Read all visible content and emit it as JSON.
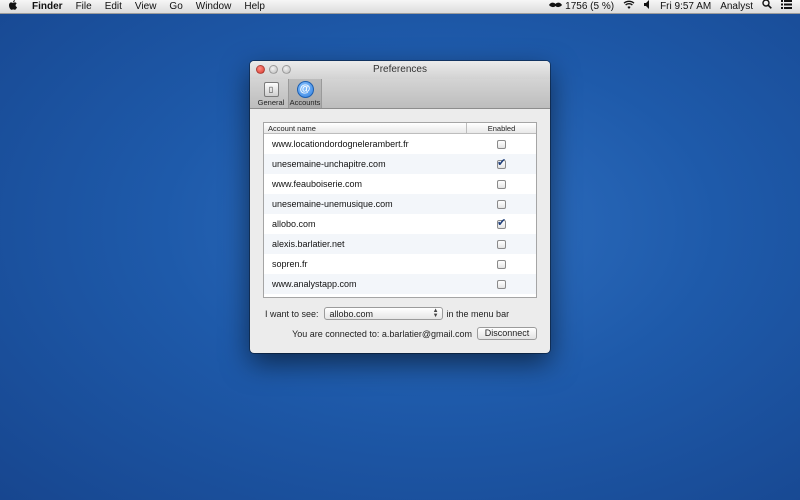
{
  "menubar": {
    "apple": "",
    "app": "Finder",
    "items": [
      "File",
      "Edit",
      "View",
      "Go",
      "Window",
      "Help"
    ],
    "status": {
      "activity": "1756 (5 %)",
      "clock": "Fri 9:57 AM",
      "user": "Analyst"
    }
  },
  "window": {
    "title": "Preferences",
    "tabs": [
      {
        "label": "General",
        "icon": "general-icon"
      },
      {
        "label": "Accounts",
        "icon": "at-sign-icon"
      }
    ],
    "table": {
      "headers": {
        "account": "Account name",
        "enabled": "Enabled"
      },
      "rows": [
        {
          "account": "www.locationdordognelerambert.fr",
          "enabled": false
        },
        {
          "account": "unesemaine-unchapitre.com",
          "enabled": true
        },
        {
          "account": "www.feauboiserie.com",
          "enabled": false
        },
        {
          "account": "unesemaine-unemusique.com",
          "enabled": false
        },
        {
          "account": "allobo.com",
          "enabled": true
        },
        {
          "account": "alexis.barlatier.net",
          "enabled": false
        },
        {
          "account": "sopren.fr",
          "enabled": false
        },
        {
          "account": "www.analystapp.com",
          "enabled": false
        }
      ]
    },
    "menu_select": {
      "prefix": "I want to see:",
      "value": "allobo.com",
      "suffix": "in the menu bar"
    },
    "connection": {
      "text": "You are connected to: a.barlatier@gmail.com",
      "button": "Disconnect"
    }
  },
  "colors": {
    "desktop": "#1e5aaa",
    "check": "#1f3f7a"
  }
}
